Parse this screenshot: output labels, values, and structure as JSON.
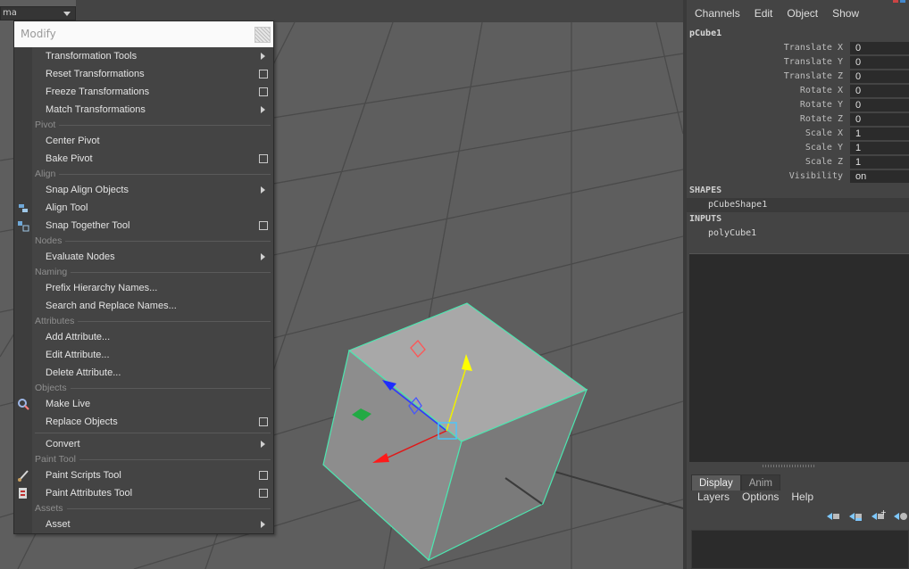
{
  "viewport": {
    "camera_label": "ma"
  },
  "menu": {
    "title": "Modify",
    "items": [
      {
        "kind": "item",
        "label": "Transformation Tools",
        "submenu": true
      },
      {
        "kind": "item",
        "label": "Reset Transformations",
        "option_box": true
      },
      {
        "kind": "item",
        "label": "Freeze Transformations",
        "option_box": true
      },
      {
        "kind": "item",
        "label": "Match Transformations",
        "submenu": true
      },
      {
        "kind": "section",
        "label": "Pivot"
      },
      {
        "kind": "item",
        "label": "Center Pivot"
      },
      {
        "kind": "item",
        "label": "Bake Pivot",
        "option_box": true
      },
      {
        "kind": "section",
        "label": "Align"
      },
      {
        "kind": "item",
        "label": "Snap Align Objects",
        "submenu": true
      },
      {
        "kind": "item",
        "label": "Align Tool",
        "icon": "align-tool-icon"
      },
      {
        "kind": "item",
        "label": "Snap Together Tool",
        "option_box": true,
        "icon": "snap-together-icon"
      },
      {
        "kind": "section",
        "label": "Nodes"
      },
      {
        "kind": "item",
        "label": "Evaluate Nodes",
        "submenu": true
      },
      {
        "kind": "section",
        "label": "Naming"
      },
      {
        "kind": "item",
        "label": "Prefix Hierarchy Names..."
      },
      {
        "kind": "item",
        "label": "Search and Replace Names..."
      },
      {
        "kind": "section",
        "label": "Attributes"
      },
      {
        "kind": "item",
        "label": "Add Attribute..."
      },
      {
        "kind": "item",
        "label": "Edit Attribute..."
      },
      {
        "kind": "item",
        "label": "Delete Attribute..."
      },
      {
        "kind": "section",
        "label": "Objects"
      },
      {
        "kind": "item",
        "label": "Make Live",
        "icon": "magnet-icon"
      },
      {
        "kind": "item",
        "label": "Replace Objects",
        "option_box": true
      },
      {
        "kind": "divider"
      },
      {
        "kind": "item",
        "label": "Convert",
        "submenu": true
      },
      {
        "kind": "section",
        "label": "Paint Tool"
      },
      {
        "kind": "item",
        "label": "Paint Scripts Tool",
        "option_box": true,
        "icon": "paint-brush-icon"
      },
      {
        "kind": "item",
        "label": "Paint Attributes Tool",
        "option_box": true,
        "icon": "paint-attributes-icon"
      },
      {
        "kind": "section",
        "label": "Assets"
      },
      {
        "kind": "item",
        "label": "Asset",
        "submenu": true
      }
    ]
  },
  "channel_box": {
    "menus": [
      "Channels",
      "Edit",
      "Object",
      "Show"
    ],
    "object_name": "pCube1",
    "attributes": [
      {
        "label": "Translate X",
        "value": "0"
      },
      {
        "label": "Translate Y",
        "value": "0"
      },
      {
        "label": "Translate Z",
        "value": "0"
      },
      {
        "label": "Rotate X",
        "value": "0"
      },
      {
        "label": "Rotate Y",
        "value": "0"
      },
      {
        "label": "Rotate Z",
        "value": "0"
      },
      {
        "label": "Scale X",
        "value": "1"
      },
      {
        "label": "Scale Y",
        "value": "1"
      },
      {
        "label": "Scale Z",
        "value": "1"
      },
      {
        "label": "Visibility",
        "value": "on"
      }
    ],
    "shapes_header": "SHAPES",
    "shape_node": "pCubeShape1",
    "inputs_header": "INPUTS",
    "input_node": "polyCube1"
  },
  "layer_editor": {
    "tabs": [
      "Display",
      "Anim"
    ],
    "active_tab": "Display",
    "menus": [
      "Layers",
      "Options",
      "Help"
    ]
  }
}
